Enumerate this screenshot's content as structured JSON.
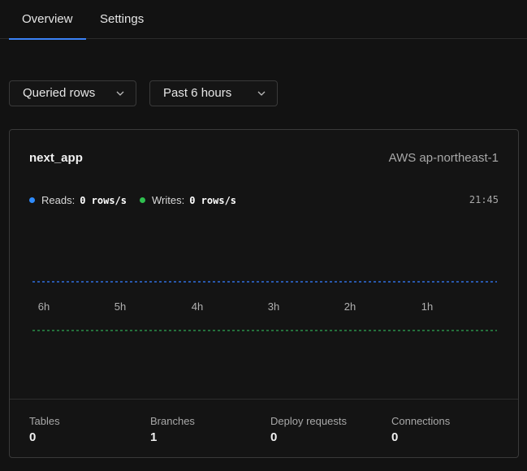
{
  "tabs": [
    {
      "label": "Overview",
      "active": true
    },
    {
      "label": "Settings",
      "active": false
    }
  ],
  "filters": {
    "metric": "Queried rows",
    "range": "Past 6 hours"
  },
  "card": {
    "database": "next_app",
    "region": "AWS ap-northeast-1",
    "time": "21:45",
    "legend": [
      {
        "label": "Reads:",
        "value": "0 rows/s",
        "color": "#2f8cff"
      },
      {
        "label": "Writes:",
        "value": "0 rows/s",
        "color": "#2fbf4f"
      }
    ]
  },
  "chart_data": {
    "type": "line",
    "x": [
      "6h",
      "5h",
      "4h",
      "3h",
      "2h",
      "1h"
    ],
    "series": [
      {
        "name": "Reads",
        "color": "#2f6fe0",
        "values": [
          0,
          0,
          0,
          0,
          0,
          0,
          0
        ]
      },
      {
        "name": "Writes",
        "color": "#2a8f49",
        "values": [
          0,
          0,
          0,
          0,
          0,
          0,
          0
        ]
      }
    ]
  },
  "stats": [
    {
      "label": "Tables",
      "value": "0"
    },
    {
      "label": "Branches",
      "value": "1"
    },
    {
      "label": "Deploy requests",
      "value": "0"
    },
    {
      "label": "Connections",
      "value": "0"
    }
  ]
}
